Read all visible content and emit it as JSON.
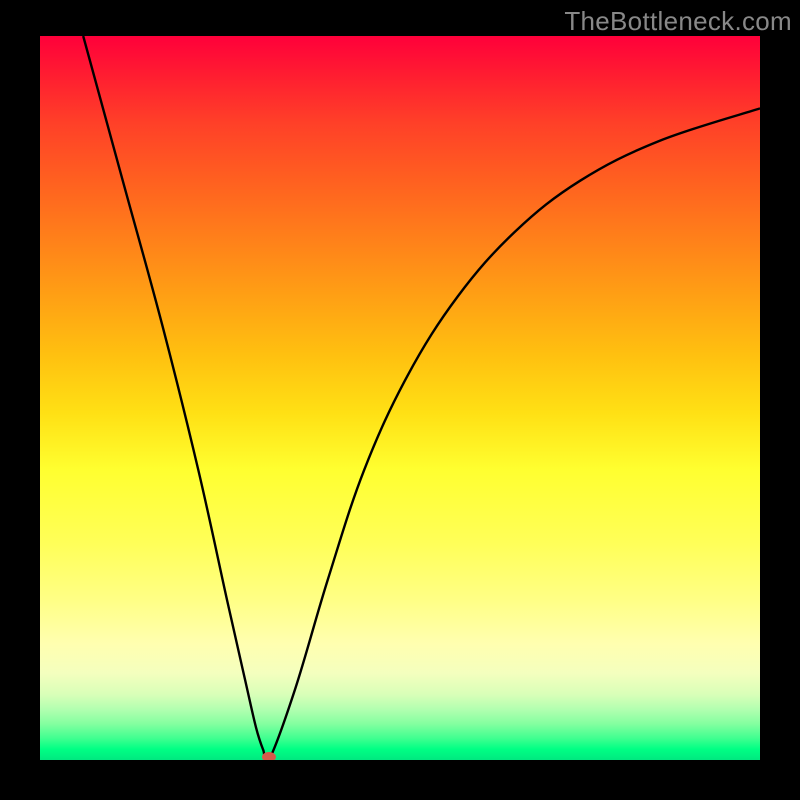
{
  "watermark": "TheBottleneck.com",
  "chart_data": {
    "type": "line",
    "title": "",
    "xlabel": "",
    "ylabel": "",
    "xlim": [
      0,
      100
    ],
    "ylim": [
      0,
      100
    ],
    "grid": false,
    "series": [
      {
        "name": "curve",
        "x": [
          6,
          11.5,
          17,
          22,
          26,
          28.5,
          30,
          31,
          31.8,
          35.5,
          40,
          45,
          51,
          58,
          66,
          75,
          86,
          100
        ],
        "values": [
          100,
          80,
          60,
          40,
          22,
          11,
          4.5,
          1.4,
          0,
          10,
          25,
          40,
          53,
          64,
          73,
          80,
          85.5,
          90
        ]
      }
    ],
    "annotations": [
      {
        "type": "dot",
        "x": 31.8,
        "y": 0,
        "color": "#d65a4a"
      }
    ],
    "background_gradient": {
      "direction": "vertical",
      "stops": [
        {
          "pos": 0,
          "color": "#ff003a"
        },
        {
          "pos": 50,
          "color": "#ffe014"
        },
        {
          "pos": 80,
          "color": "#ffff86"
        },
        {
          "pos": 100,
          "color": "#00e880"
        }
      ]
    }
  }
}
